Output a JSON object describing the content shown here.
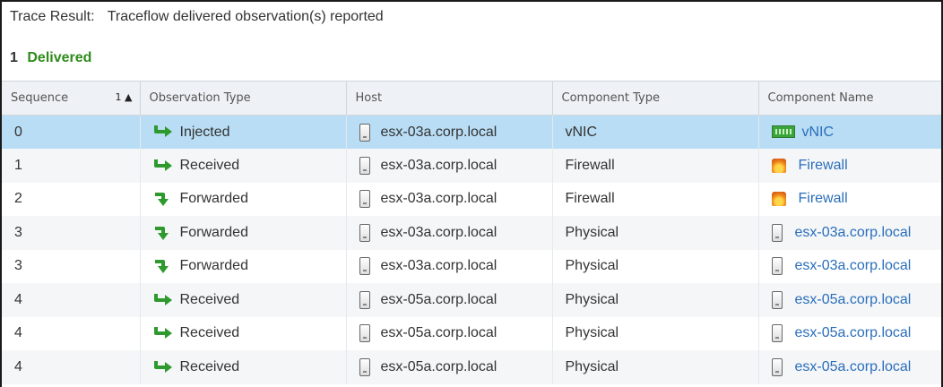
{
  "header": {
    "label": "Trace Result:",
    "text": "Traceflow delivered observation(s) reported"
  },
  "summary": {
    "count": "1",
    "status": "Delivered"
  },
  "columns": {
    "sequence": "Sequence",
    "sort_indicator": "1 ▲",
    "observation_type": "Observation Type",
    "host": "Host",
    "component_type": "Component Type",
    "component_name": "Component Name"
  },
  "rows": [
    {
      "seq": "0",
      "obs": "Injected",
      "obs_icon": "hook-arrow-right-icon",
      "host": "esx-03a.corp.local",
      "ctype": "vNIC",
      "cname": "vNIC",
      "cname_icon": "vnic-icon"
    },
    {
      "seq": "1",
      "obs": "Received",
      "obs_icon": "hook-arrow-right-icon",
      "host": "esx-03a.corp.local",
      "ctype": "Firewall",
      "cname": "Firewall",
      "cname_icon": "firewall-icon"
    },
    {
      "seq": "2",
      "obs": "Forwarded",
      "obs_icon": "turn-down-arrow-icon",
      "host": "esx-03a.corp.local",
      "ctype": "Firewall",
      "cname": "Firewall",
      "cname_icon": "firewall-icon"
    },
    {
      "seq": "3",
      "obs": "Forwarded",
      "obs_icon": "turn-down-arrow-icon",
      "host": "esx-03a.corp.local",
      "ctype": "Physical",
      "cname": "esx-03a.corp.local",
      "cname_icon": "host-icon"
    },
    {
      "seq": "3",
      "obs": "Forwarded",
      "obs_icon": "turn-down-arrow-icon",
      "host": "esx-03a.corp.local",
      "ctype": "Physical",
      "cname": "esx-03a.corp.local",
      "cname_icon": "host-icon"
    },
    {
      "seq": "4",
      "obs": "Received",
      "obs_icon": "hook-arrow-right-icon",
      "host": "esx-05a.corp.local",
      "ctype": "Physical",
      "cname": "esx-05a.corp.local",
      "cname_icon": "host-icon"
    },
    {
      "seq": "4",
      "obs": "Received",
      "obs_icon": "hook-arrow-right-icon",
      "host": "esx-05a.corp.local",
      "ctype": "Physical",
      "cname": "esx-05a.corp.local",
      "cname_icon": "host-icon"
    },
    {
      "seq": "4",
      "obs": "Received",
      "obs_icon": "hook-arrow-right-icon",
      "host": "esx-05a.corp.local",
      "ctype": "Physical",
      "cname": "esx-05a.corp.local",
      "cname_icon": "host-icon"
    }
  ],
  "colors": {
    "delivered": "#2e8b1a",
    "link": "#2a6ebb",
    "selected_row": "#b9ddf4",
    "arrow": "#2e9a2e"
  }
}
